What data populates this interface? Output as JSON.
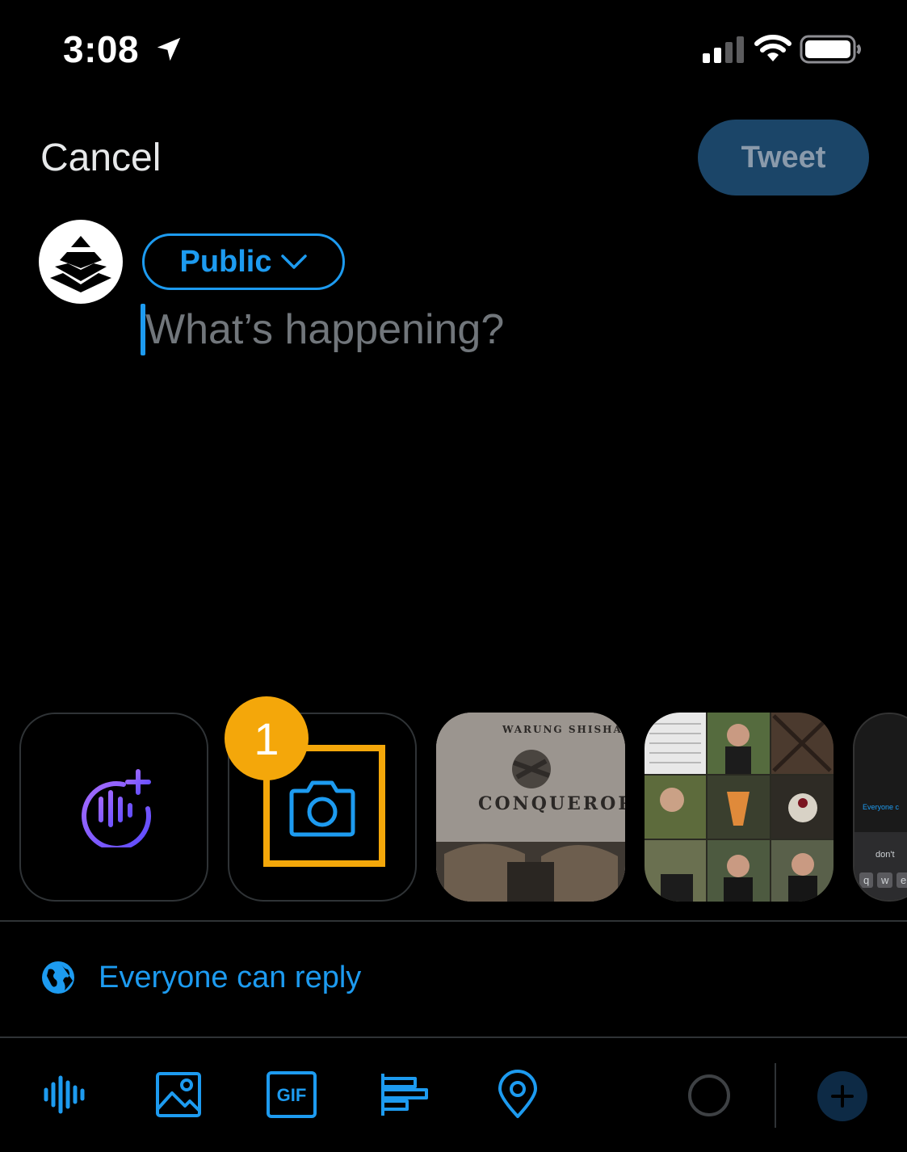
{
  "status_bar": {
    "time": "3:08",
    "icons": [
      "location-arrow-icon",
      "signal-icon",
      "wifi-icon",
      "battery-icon"
    ]
  },
  "header": {
    "cancel_label": "Cancel",
    "tweet_label": "Tweet"
  },
  "composer": {
    "audience_label": "Public",
    "placeholder": "What’s happening?"
  },
  "media_carousel": {
    "items": [
      {
        "name": "spaces-voice",
        "icon": "spaces-add-icon"
      },
      {
        "name": "camera",
        "icon": "camera-icon"
      },
      {
        "name": "photo",
        "wall_text_top": "WARUNG SHISHA",
        "wall_text_main": "CONQUEROR"
      },
      {
        "name": "photo",
        "type": "collage"
      },
      {
        "name": "photo",
        "type": "screenshot",
        "snippet_reply": "Everyone c",
        "snippet_word": "don't",
        "snippet_keys": [
          "q",
          "w",
          "e"
        ]
      }
    ]
  },
  "annotation": {
    "step_number": "1",
    "highlight_color": "#f4a70a"
  },
  "reply_setting": {
    "label": "Everyone can reply",
    "icon": "globe-icon"
  },
  "toolbar": {
    "tools": [
      "voice-wave-icon",
      "image-icon",
      "gif-icon",
      "poll-icon",
      "location-pin-icon"
    ],
    "gif_text": "GIF"
  },
  "colors": {
    "accent": "#1d9bf0",
    "tweet_button_bg": "#1b4568",
    "background": "#000000",
    "annotation": "#f4a70a"
  }
}
